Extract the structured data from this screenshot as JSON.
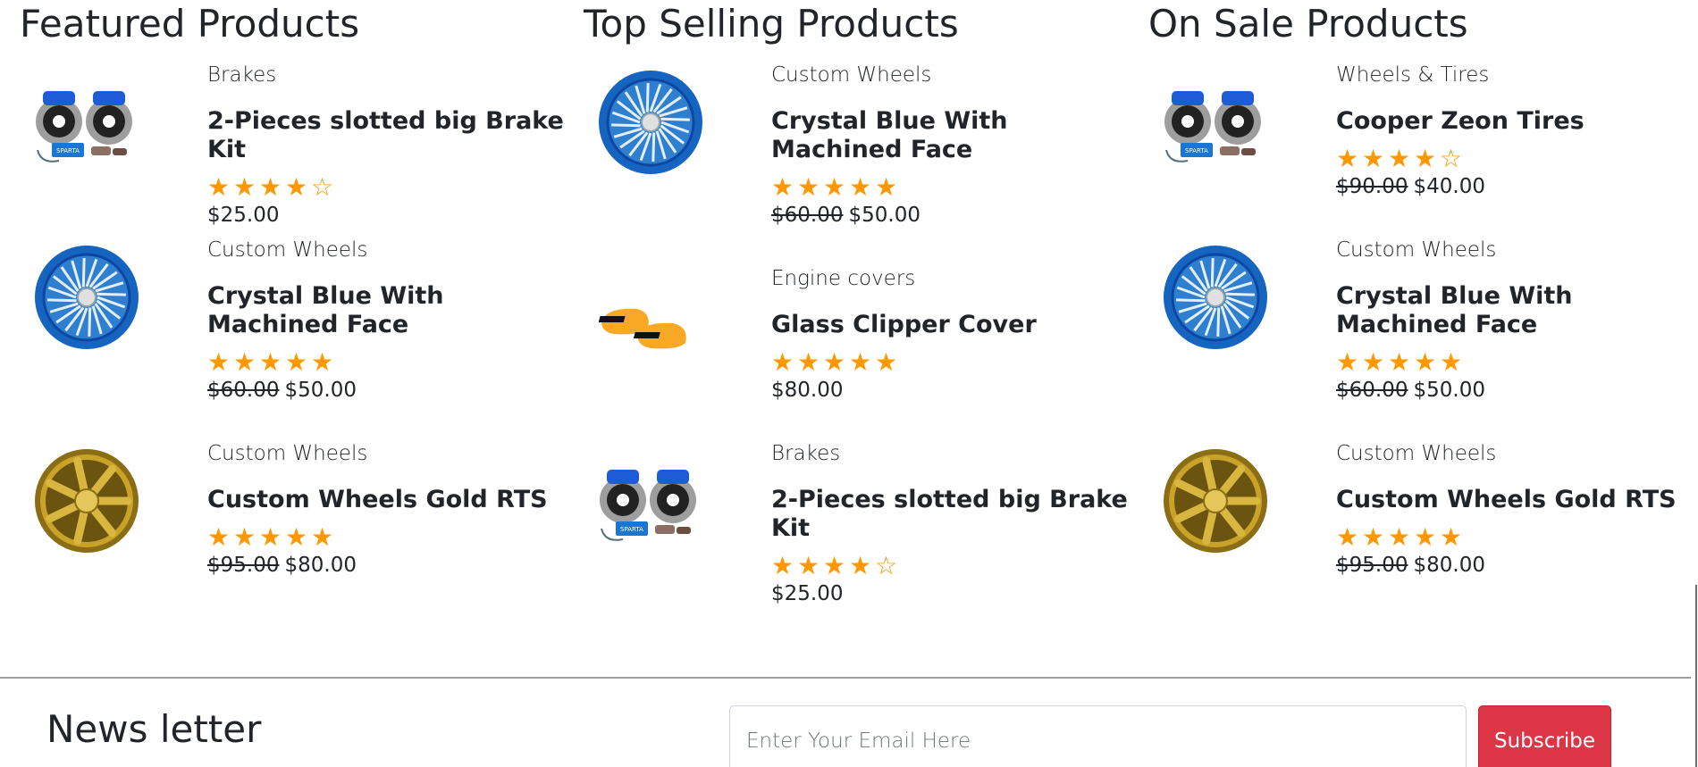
{
  "colors": {
    "star": "#ff9800",
    "subscribe_bg": "#dc3545",
    "wheel_blue": "#1565c0",
    "gold": "#c9a227",
    "caliper_blue": "#1e5bd6",
    "engine_cover": "#f9a825"
  },
  "sections": [
    {
      "title": "Featured Products",
      "products": [
        {
          "image_icon": "brake-kit-icon",
          "category": "Brakes",
          "name": "2-Pieces slotted big Brake Kit",
          "rating": 4,
          "old_price": "",
          "price": "$25.00"
        },
        {
          "image_icon": "blue-wheel-icon",
          "category": "Custom Wheels",
          "name": "Crystal Blue With Machined Face",
          "rating": 5,
          "old_price": "$60.00",
          "price": "$50.00"
        },
        {
          "image_icon": "gold-wheel-icon",
          "category": "Custom Wheels",
          "name": "Custom Wheels Gold RTS",
          "rating": 5,
          "old_price": "$95.00",
          "price": "$80.00"
        }
      ]
    },
    {
      "title": "Top Selling Products",
      "products": [
        {
          "image_icon": "blue-wheel-icon",
          "category": "Custom Wheels",
          "name": "Crystal Blue With Machined Face",
          "rating": 5,
          "old_price": "$60.00",
          "price": "$50.00"
        },
        {
          "image_icon": "engine-cover-icon",
          "category": "Engine covers",
          "name": "Glass Clipper Cover",
          "rating": 5,
          "old_price": "",
          "price": "$80.00"
        },
        {
          "image_icon": "brake-kit-icon",
          "category": "Brakes",
          "name": "2-Pieces slotted big Brake Kit",
          "rating": 4,
          "old_price": "",
          "price": "$25.00"
        }
      ]
    },
    {
      "title": "On Sale Products",
      "products": [
        {
          "image_icon": "brake-kit-icon",
          "category": "Wheels & Tires",
          "name": "Cooper Zeon Tires",
          "rating": 4,
          "old_price": "$90.00",
          "price": "$40.00"
        },
        {
          "image_icon": "blue-wheel-icon",
          "category": "Custom Wheels",
          "name": "Crystal Blue With Machined Face",
          "rating": 5,
          "old_price": "$60.00",
          "price": "$50.00"
        },
        {
          "image_icon": "gold-wheel-icon",
          "category": "Custom Wheels",
          "name": "Custom Wheels Gold RTS",
          "rating": 5,
          "old_price": "$95.00",
          "price": "$80.00"
        }
      ]
    }
  ],
  "newsletter": {
    "title": "News letter",
    "email_placeholder": "Enter Your Email Here",
    "email_value": "",
    "subscribe_label": "Subscribe"
  }
}
